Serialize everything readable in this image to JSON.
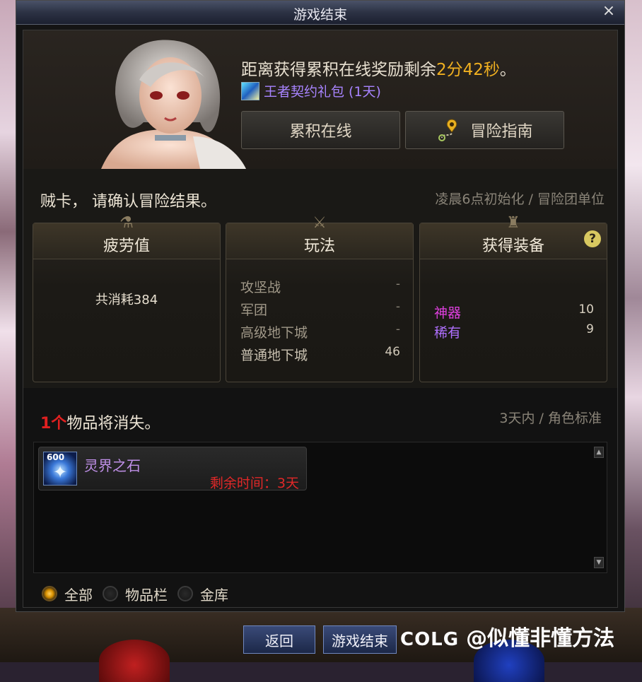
{
  "window": {
    "title": "游戏结束",
    "close_label": "×"
  },
  "reward": {
    "prefix": "距离获得累积在线奖励剩余",
    "time": "2分42秒",
    "suffix": "。",
    "gift_label": "王者契约礼包 (1天)"
  },
  "buttons": {
    "accumulate_online": "累积在线",
    "adventure_guide": "冒险指南"
  },
  "confirm": {
    "text": "贼卡，  请确认冒险结果。",
    "note": "凌晨6点初始化 / 冒险团单位"
  },
  "panels": {
    "fatigue": {
      "title": "疲劳值",
      "consume": "共消耗384"
    },
    "play": {
      "title": "玩法",
      "rows": [
        {
          "label": "攻坚战",
          "value": "-"
        },
        {
          "label": "军团",
          "value": "-"
        },
        {
          "label": "高级地下城",
          "value": "-"
        },
        {
          "label": "普通地下城",
          "value": "46"
        }
      ]
    },
    "equipment": {
      "title": "获得装备",
      "help": "?",
      "rows": [
        {
          "label": "神器",
          "value": "10",
          "color": "#e040e0"
        },
        {
          "label": "稀有",
          "value": "9",
          "color": "#b070ff"
        }
      ]
    }
  },
  "vanish": {
    "count": "1个",
    "text": "物品将消失。",
    "note": "3天内 / 角色标准"
  },
  "items": [
    {
      "name": "灵界之石",
      "quantity": "600",
      "remaining": "剩余时间：3天",
      "icon": "crystal-icon"
    }
  ],
  "filters": {
    "all": "全部",
    "inventory": "物品栏",
    "vault": "金库",
    "selected": "all"
  },
  "footer": {
    "back": "返回",
    "end_game": "游戏结束"
  },
  "watermark": {
    "brand": "COLG",
    "handle": "@似懂非懂方法"
  }
}
